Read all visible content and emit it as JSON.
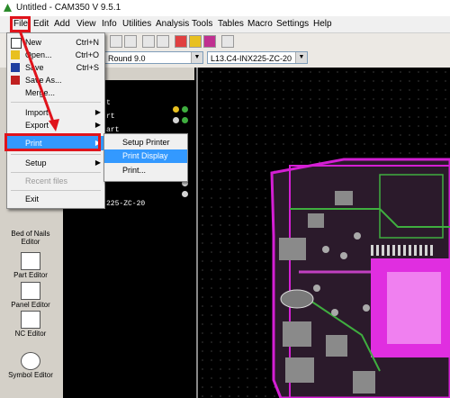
{
  "window": {
    "title": "Untitled - CAM350 V 9.5.1"
  },
  "menubar": [
    "File",
    "Edit",
    "Add",
    "View",
    "Info",
    "Utilities",
    "Analysis",
    "Tools",
    "Tables",
    "Macro",
    "Settings",
    "Help"
  ],
  "toolbar2": {
    "combo1": "Round 9.0",
    "combo2": "L13.C4-INX225-ZC-20"
  },
  "file_menu": {
    "items": [
      {
        "label": "New",
        "accel": "Ctrl+N",
        "icon": "new-file-icon"
      },
      {
        "label": "Open...",
        "accel": "Ctrl+O",
        "icon": "open-folder-icon"
      },
      {
        "label": "Save",
        "accel": "Ctrl+S",
        "icon": "save-icon"
      },
      {
        "label": "Save As...",
        "icon": "save-as-icon"
      },
      {
        "label": "Merge..."
      },
      {
        "label": "Import"
      },
      {
        "label": "Export"
      },
      {
        "label": "Print"
      },
      {
        "label": "Setup"
      },
      {
        "label": "Recent files"
      },
      {
        "label": "Exit"
      }
    ]
  },
  "print_submenu": [
    "Setup Printer",
    "Print Display",
    "Print..."
  ],
  "sidebar": [
    "Bed of Nails Editor",
    "Part Editor",
    "Panel Editor",
    "NC Editor",
    "Symbol Editor"
  ],
  "layer_panel": {
    "rows": [
      "t",
      "rt",
      "art",
      "rt",
      "225-ZC-20"
    ]
  },
  "colors": {
    "highlight": "#3399ff",
    "annotation": "#e0141c",
    "pcb_magenta": "#d41fd4",
    "pcb_green": "#3fae3f",
    "pcb_gray": "#8a8a8a"
  }
}
